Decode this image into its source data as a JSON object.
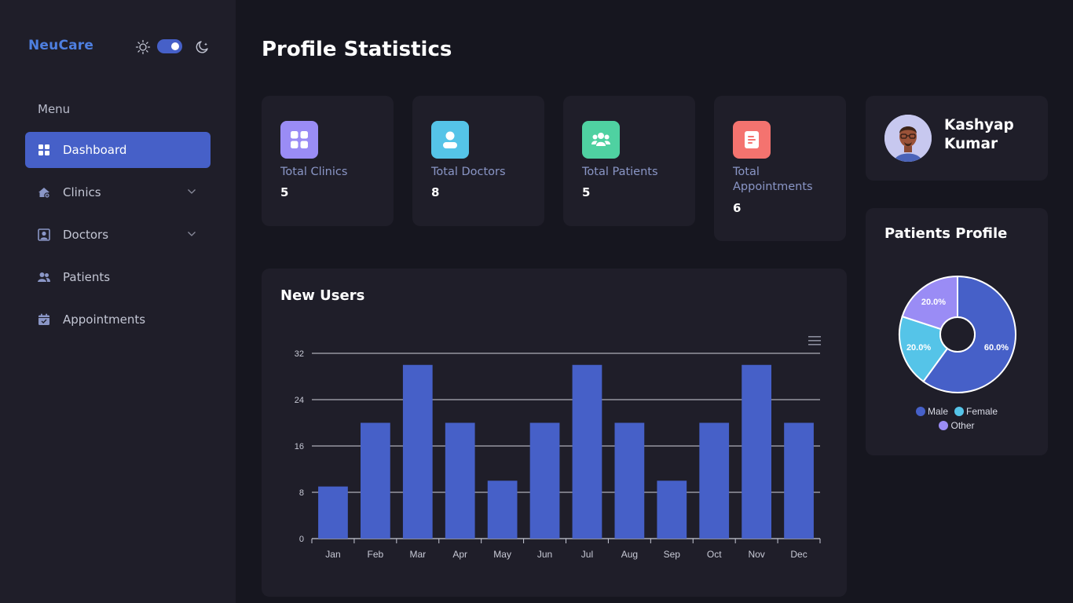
{
  "sidebar": {
    "brand": "NeuCare",
    "menu_label": "Menu",
    "items": [
      {
        "label": "Dashboard",
        "icon": "grid-icon",
        "active": true,
        "has_submenu": false
      },
      {
        "label": "Clinics",
        "icon": "clinic-icon",
        "active": false,
        "has_submenu": true
      },
      {
        "label": "Doctors",
        "icon": "doctor-icon",
        "active": false,
        "has_submenu": true
      },
      {
        "label": "Patients",
        "icon": "users-icon",
        "active": false,
        "has_submenu": false
      },
      {
        "label": "Appointments",
        "icon": "calendar-icon",
        "active": false,
        "has_submenu": false
      }
    ],
    "theme_toggle": {
      "mode": "dark"
    }
  },
  "header": {
    "title": "Profile Statistics"
  },
  "stats": [
    {
      "label": "Total Clinics",
      "value": "5",
      "icon": "grid-icon",
      "color": "#9a8cf5"
    },
    {
      "label": "Total Doctors",
      "value": "8",
      "icon": "user-icon",
      "color": "#55c4e8"
    },
    {
      "label": "Total Patients",
      "value": "5",
      "icon": "group-icon",
      "color": "#4fd1a1"
    },
    {
      "label": "Total Appointments",
      "value": "6",
      "icon": "document-icon",
      "color": "#f4736f"
    }
  ],
  "profile": {
    "name": "Kashyap Kumar"
  },
  "new_users": {
    "title": "New Users"
  },
  "patients_profile": {
    "title": "Patients Profile"
  },
  "colors": {
    "accent": "#4660c8",
    "bar": "#4660c8",
    "male": "#4660c8",
    "female": "#55c4e8",
    "other": "#9a8cf5"
  },
  "chart_data": [
    {
      "type": "bar",
      "title": "New Users",
      "categories": [
        "Jan",
        "Feb",
        "Mar",
        "Apr",
        "May",
        "Jun",
        "Jul",
        "Aug",
        "Sep",
        "Oct",
        "Nov",
        "Dec"
      ],
      "values": [
        9,
        20,
        30,
        20,
        10,
        20,
        30,
        20,
        10,
        20,
        30,
        20
      ],
      "ylim": [
        0,
        32
      ],
      "yticks": [
        0,
        8,
        16,
        24,
        32
      ],
      "grid": true
    },
    {
      "type": "pie",
      "title": "Patients Profile",
      "labels": [
        "Male",
        "Female",
        "Other"
      ],
      "values": [
        60.0,
        20.0,
        20.0
      ],
      "value_labels": [
        "60.0%",
        "20.0%",
        "20.0%"
      ],
      "donut": true,
      "legend": "bottom"
    }
  ]
}
